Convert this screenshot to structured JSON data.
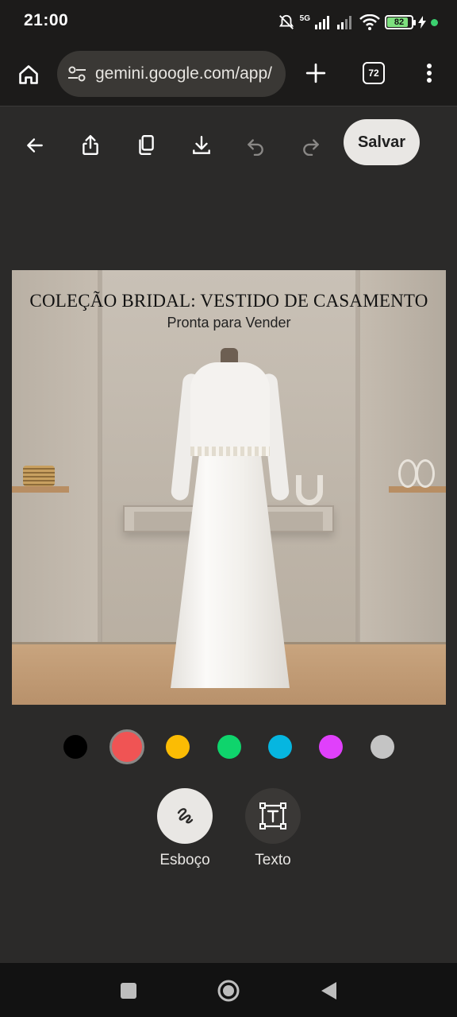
{
  "status": {
    "time": "21:00",
    "network": "5G",
    "battery": "82"
  },
  "browser": {
    "url": "gemini.google.com/app/",
    "tab_count": "72"
  },
  "toolbar": {
    "save_label": "Salvar"
  },
  "image": {
    "title": "COLEÇÃO BRIDAL: VESTIDO DE CASAMENTO",
    "subtitle": "Pronta para Vender"
  },
  "palette": {
    "colors": [
      "#000000",
      "#f05454",
      "#fbbc04",
      "#0fd46c",
      "#06b6e0",
      "#e040fb",
      "#c4c4c4"
    ],
    "selected_index": 1
  },
  "tools": {
    "sketch_label": "Esboço",
    "text_label": "Texto",
    "active": "sketch"
  },
  "icons": {
    "home": "home-icon",
    "site_settings": "tune-icon",
    "new_tab": "plus-icon",
    "menu": "more-vert-icon",
    "back": "arrow-back-icon",
    "share": "share-icon",
    "copy": "copy-icon",
    "download": "download-icon",
    "undo": "undo-icon",
    "redo": "redo-icon",
    "sketch": "scribble-icon",
    "text": "text-box-icon"
  }
}
